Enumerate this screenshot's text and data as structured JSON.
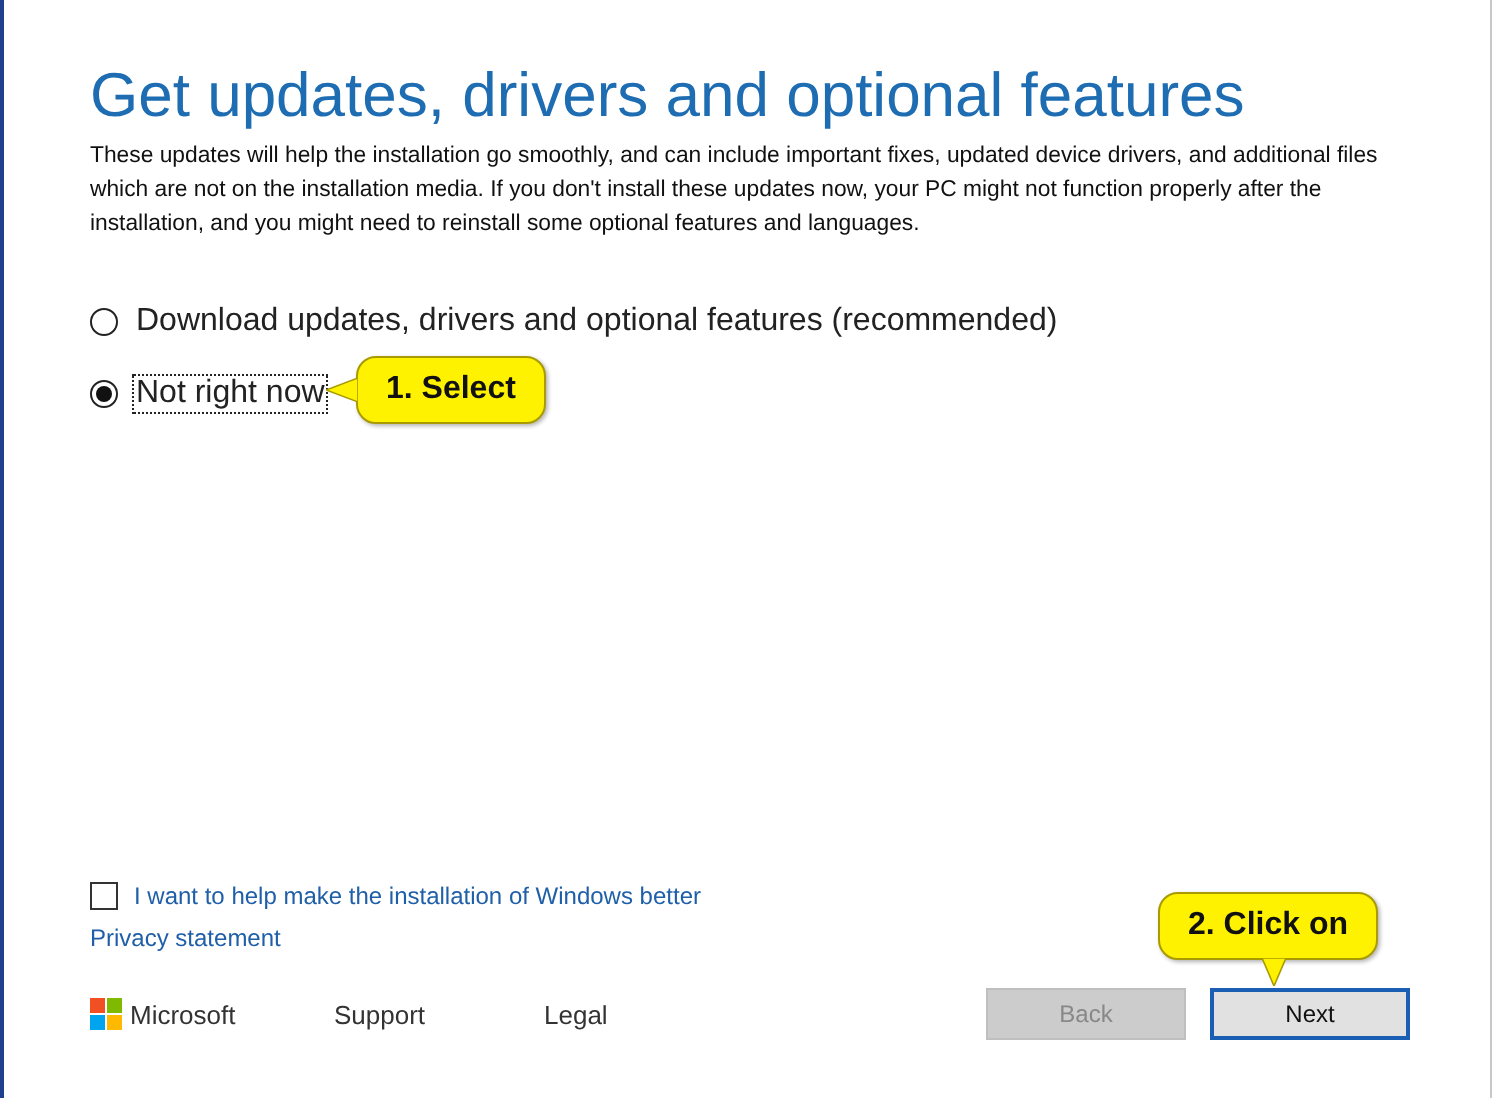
{
  "title": "Get updates, drivers and optional features",
  "description": "These updates will help the installation go smoothly, and can include important fixes, updated device drivers, and additional files which are not on the installation media. If you don't install these updates now, your PC might not function properly after the installation, and you might need to reinstall some optional features and languages.",
  "options": [
    {
      "label": "Download updates, drivers and optional features (recommended)",
      "selected": false,
      "focused": false
    },
    {
      "label": "Not right now",
      "selected": true,
      "focused": true
    }
  ],
  "callouts": [
    {
      "text": "1. Select",
      "kind": "left"
    },
    {
      "text": "2. Click on",
      "kind": "down"
    }
  ],
  "help_checkbox": {
    "label": "I want to help make the installation of Windows better",
    "checked": false
  },
  "privacy_link": "Privacy statement",
  "footer": {
    "brand": "Microsoft",
    "links": [
      "Support",
      "Legal"
    ]
  },
  "buttons": [
    {
      "label": "Back",
      "disabled": true,
      "default": false
    },
    {
      "label": "Next",
      "disabled": false,
      "default": true
    }
  ]
}
